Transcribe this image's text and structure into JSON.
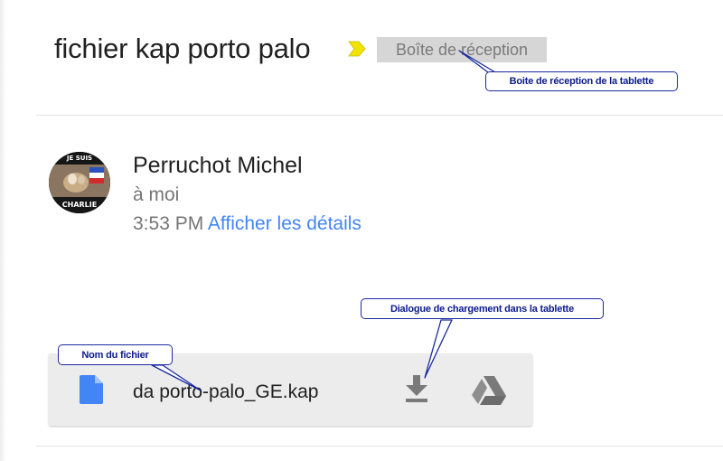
{
  "message": {
    "subject": "fichier kap porto palo",
    "label": "Boîte de réception",
    "sender": {
      "name": "Perruchot Michel",
      "recipient": "à moi",
      "avatar_text_top": "JE SUIS",
      "avatar_text_bottom": "CHARLIE"
    },
    "time": "3:53 PM",
    "details_link": "Afficher les détails"
  },
  "attachment": {
    "file_name": "da porto-palo_GE.kap",
    "icons": {
      "file": "document-icon",
      "download": "download-icon",
      "drive": "google-drive-icon"
    }
  },
  "annotations": {
    "reception": "Boite de réception de la tablette",
    "download": "Dialogue de chargement dans la tablette",
    "filename": "Nom du fichier"
  },
  "colors": {
    "link": "#4285f4",
    "importance": "#f2e200",
    "file_icon": "#4285f4",
    "annotation_text": "#0b1a8c"
  }
}
